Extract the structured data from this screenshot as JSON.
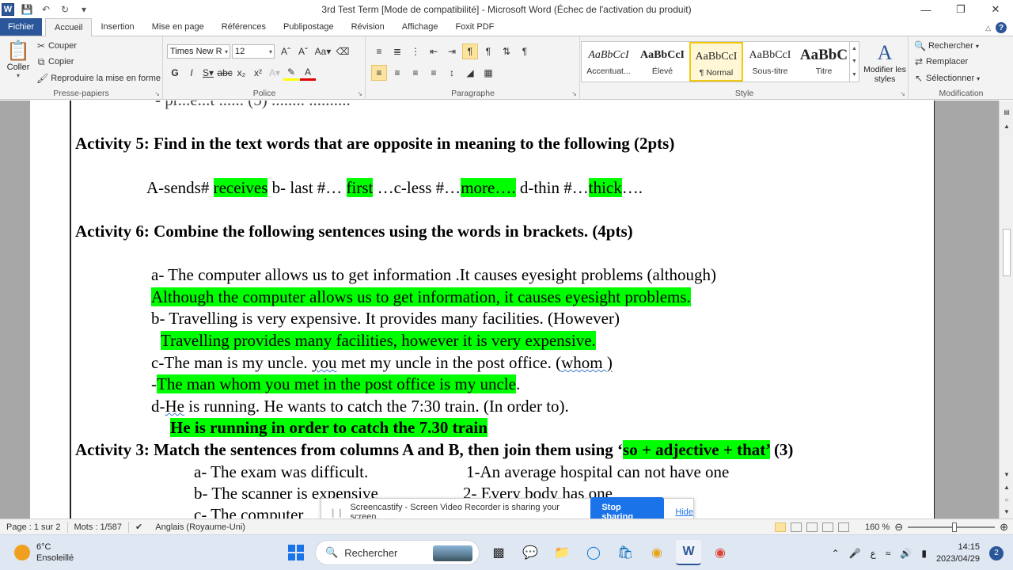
{
  "titlebar": {
    "title": "3rd Test Term [Mode de compatibilité]  -  Microsoft Word (Échec de l'activation du produit)",
    "app_logo": "W"
  },
  "tabs": [
    {
      "label": "Fichier"
    },
    {
      "label": "Accueil"
    },
    {
      "label": "Insertion"
    },
    {
      "label": "Mise en page"
    },
    {
      "label": "Références"
    },
    {
      "label": "Publipostage"
    },
    {
      "label": "Révision"
    },
    {
      "label": "Affichage"
    },
    {
      "label": "Foxit PDF"
    }
  ],
  "ribbon": {
    "clipboard": {
      "label": "Presse-papiers",
      "paste": "Coller",
      "cut": "Couper",
      "copy": "Copier",
      "format_painter": "Reproduire la mise en forme"
    },
    "font": {
      "label": "Police",
      "name": "Times New R",
      "size": "12"
    },
    "paragraph": {
      "label": "Paragraphe"
    },
    "styles": {
      "label": "Style",
      "items": [
        {
          "sample": "AaBbCcI",
          "name": "Accentuat..."
        },
        {
          "sample": "AaBbCcI",
          "name": "Élevé"
        },
        {
          "sample": "AaBbCcI",
          "name": "¶ Normal"
        },
        {
          "sample": "AaBbCcI",
          "name": "Sous-titre"
        },
        {
          "sample": "AaBbC",
          "name": "Titre"
        }
      ],
      "change_styles": "Modifier les styles"
    },
    "editing": {
      "label": "Modification",
      "find": "Rechercher",
      "replace": "Remplacer",
      "select": "Sélectionner"
    }
  },
  "document": {
    "top_partial": "- pr...e...t ...... (5)   ........ ..........",
    "activity5": {
      "title": "Activity 5: Find in the text words  that are opposite in meaning to the following (2pts)",
      "a_prefix": "A-sends# ",
      "a_answer": "receives",
      "b_prefix": " b- last #… ",
      "b_answer": "first",
      "c_prefix": " …c-less #…",
      "c_answer": "more….",
      "d_prefix": " d-thin #…",
      "d_answer": "thick",
      "d_suffix": "…."
    },
    "activity6": {
      "title": "Activity 6: Combine the following sentences using the words  in brackets. (4pts)",
      "a_q": "a- The computer allows us to get information .It causes eyesight problems (although)",
      "a_ans": "Although the computer allows us to get information, it causes eyesight problems.",
      "b_q": "b- Travelling is very expensive. It provides many facilities. (However)",
      "b_ans": "Travelling provides many facilities, however it is very expensive.",
      "c_q_pre": "c-The man is my uncle. ",
      "c_q_mid": "you",
      "c_q_post": " met my uncle in the post office. (",
      "c_q_word": "whom )",
      "c_ans_dash": "-",
      "c_ans": "The man whom you met in the post office is my uncle",
      "c_ans_end": ".",
      "d_q_pre": "d-",
      "d_q_word": "He",
      "d_q_post": " is running. He wants to catch the 7:30 train. (In order to).",
      "d_ans": "He is running in order to catch the 7.30 train"
    },
    "activity3": {
      "title_pre": "Activity 3: Match the sentences from columns A and B, then join them using ‘",
      "title_hl": "so + adjective + that’",
      "title_post": " (3)",
      "a_left": "a- The exam was difficult.",
      "a_right": "1-An average hospital can not have one",
      "b_left": "b- The scanner is expensive",
      "b_right": "2- Every body has one",
      "c_left": "c- The computer"
    }
  },
  "screencastify": {
    "message": "Screencastify - Screen Video Recorder is sharing your screen.",
    "stop": "Stop sharing",
    "hide": "Hide"
  },
  "statusbar": {
    "page": "Page : 1 sur 2",
    "words": "Mots : 1/587",
    "language": "Anglais (Royaume-Uni)",
    "zoom": "160 %"
  },
  "taskbar": {
    "weather_temp": "6°C",
    "weather_desc": "Ensoleillé",
    "search": "Rechercher",
    "time": "14:15",
    "date": "2023/04/29",
    "notifications": "2",
    "ime": "ع"
  },
  "colors": {
    "highlight": "#00ff00",
    "word_blue": "#2b579a",
    "accent_blue": "#1a73e8"
  }
}
